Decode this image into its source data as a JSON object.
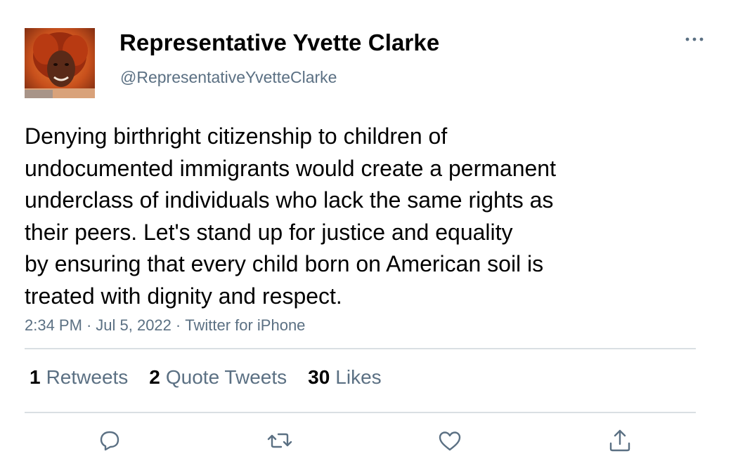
{
  "author": {
    "name": "Representative Yvette Clarke",
    "handle": "@RepresentativeYvetteClarke"
  },
  "tweet": {
    "lines": [
      "Denying birthright citizenship to children of",
      "undocumented immigrants would create a permanent",
      "underclass of individuals who lack the same rights as",
      "their peers. Let's stand up for justice and equality",
      "by ensuring that every child born on American soil is",
      "treated with dignity and respect."
    ],
    "time": "2:34 PM",
    "date": "Jul 5, 2022",
    "source": "Twitter for iPhone",
    "separator": "·"
  },
  "stats": {
    "retweets": {
      "count": "1",
      "label": "Retweets"
    },
    "quotes": {
      "count": "2",
      "label": "Quote Tweets"
    },
    "likes": {
      "count": "30",
      "label": "Likes"
    }
  },
  "icons": {
    "more": "more-horizontal-icon",
    "reply": "reply-bubble-icon",
    "retweet": "retweet-icon",
    "like": "heart-icon",
    "share": "share-upload-icon"
  },
  "colors": {
    "text": "#000000",
    "secondary": "#5b7083",
    "divider": "#d9dfe3",
    "icon": "#5b7083"
  }
}
